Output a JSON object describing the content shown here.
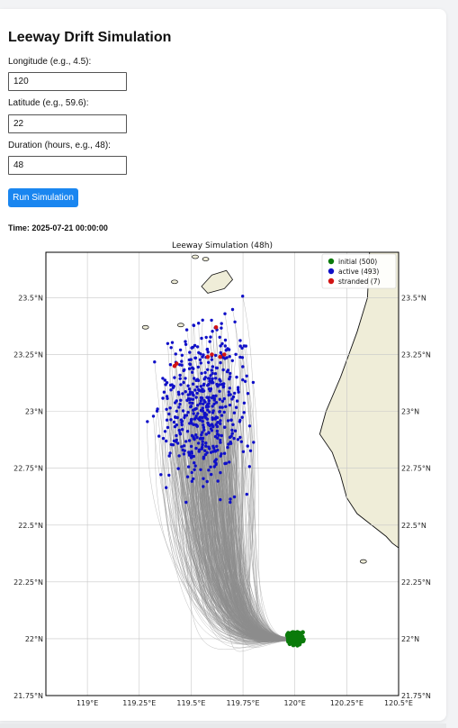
{
  "form": {
    "title": "Leeway Drift Simulation",
    "lon_label": "Longitude (e.g., 4.5):",
    "lon_value": "120",
    "lat_label": "Latitude (e.g., 59.6):",
    "lat_value": "22",
    "dur_label": "Duration (hours, e.g., 48):",
    "dur_value": "48",
    "run_label": "Run Simulation"
  },
  "time_text": "Time: 2025-07-21 00:00:00",
  "colors": {
    "initial": "#0a7a0a",
    "active": "#1010c8",
    "stranded": "#d21414",
    "trajectory": "#8c8c8c",
    "land": "#efedd8",
    "button": "#1a86f0"
  },
  "chart_data": {
    "type": "scatter",
    "title": "Leeway Simulation (48h)",
    "xlim": [
      118.8,
      120.5
    ],
    "ylim": [
      21.75,
      23.7
    ],
    "x_ticks": [
      119,
      119.25,
      119.5,
      119.75,
      120,
      120.25,
      120.5
    ],
    "x_tick_labels": [
      "119°E",
      "119.25°E",
      "119.5°E",
      "119.75°E",
      "120°E",
      "120.25°E",
      "120.5°E"
    ],
    "y_ticks": [
      21.75,
      22,
      22.25,
      22.5,
      22.75,
      23,
      23.25,
      23.5
    ],
    "y_tick_labels": [
      "21.75°N",
      "22°N",
      "22.25°N",
      "22.5°N",
      "22.75°N",
      "23°N",
      "23.25°N",
      "23.5°N"
    ],
    "grid": true,
    "legend_position": "top-right",
    "legend": [
      {
        "key": "initial",
        "label": "initial (500)"
      },
      {
        "key": "active",
        "label": "active (493)"
      },
      {
        "key": "stranded",
        "label": "stranded (7)"
      }
    ],
    "series": [
      {
        "name": "initial (500)",
        "key": "initial",
        "center": [
          120.0,
          22.0
        ],
        "spread": [
          0.015,
          0.012
        ],
        "count": 500
      },
      {
        "name": "active (493)",
        "key": "active",
        "count": 493,
        "x_range": [
          119.25,
          119.9
        ],
        "y_range": [
          22.6,
          23.55
        ]
      },
      {
        "name": "stranded (7)",
        "key": "stranded",
        "points": [
          [
            119.42,
            23.2
          ],
          [
            119.43,
            23.21
          ],
          [
            119.58,
            23.24
          ],
          [
            119.6,
            23.25
          ],
          [
            119.66,
            23.25
          ],
          [
            119.62,
            23.37
          ],
          [
            119.64,
            23.24
          ]
        ]
      }
    ],
    "land": {
      "taiwan_coast": [
        [
          120.5,
          23.7
        ],
        [
          120.36,
          23.7
        ],
        [
          120.35,
          23.5
        ],
        [
          120.3,
          23.35
        ],
        [
          120.22,
          23.15
        ],
        [
          120.15,
          23.0
        ],
        [
          120.12,
          22.9
        ],
        [
          120.18,
          22.82
        ],
        [
          120.22,
          22.72
        ],
        [
          120.25,
          22.62
        ],
        [
          120.3,
          22.55
        ],
        [
          120.37,
          22.5
        ],
        [
          120.44,
          22.45
        ],
        [
          120.47,
          22.42
        ],
        [
          120.5,
          22.4
        ]
      ],
      "penghu_main": [
        [
          119.55,
          23.55
        ],
        [
          119.6,
          23.6
        ],
        [
          119.67,
          23.62
        ],
        [
          119.7,
          23.58
        ],
        [
          119.66,
          23.54
        ],
        [
          119.58,
          23.52
        ]
      ],
      "small_islands": [
        [
          119.52,
          23.68
        ],
        [
          119.57,
          23.67
        ],
        [
          119.45,
          23.38
        ],
        [
          119.42,
          23.57
        ],
        [
          119.28,
          23.37
        ],
        [
          120.33,
          22.34
        ]
      ]
    }
  }
}
